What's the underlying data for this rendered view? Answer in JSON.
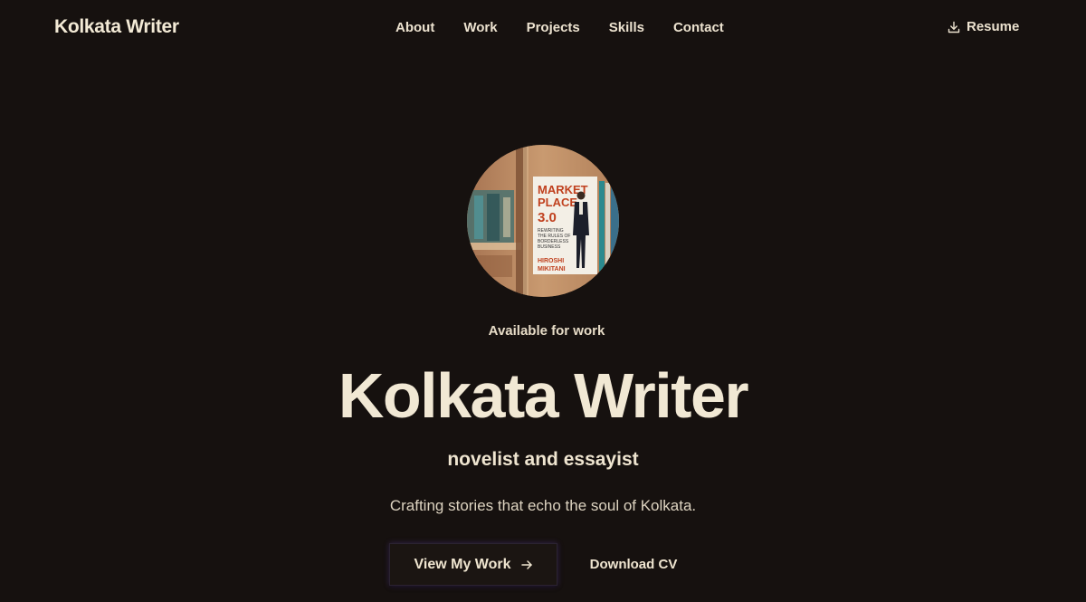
{
  "header": {
    "brand": "Kolkata Writer",
    "nav": [
      "About",
      "Work",
      "Projects",
      "Skills",
      "Contact"
    ],
    "resume_label": "Resume",
    "resume_icon": "download-icon"
  },
  "hero": {
    "avatar": {
      "book_title_line1": "MARKET",
      "book_title_line2": "PLACE",
      "book_title_line3": "3.0",
      "book_subtitle_lines": [
        "REWRITING",
        "THE RULES OF",
        "BORDERLESS",
        "BUSINESS"
      ],
      "book_author_lines": [
        "HIROSHI",
        "MIKITANI"
      ]
    },
    "availability": "Available for work",
    "title": "Kolkata Writer",
    "subtitle": "novelist and essayist",
    "tagline": "Crafting stories that echo the soul of Kolkata.",
    "primary_cta": "View My Work",
    "primary_cta_icon": "arrow-right-icon",
    "secondary_cta": "Download CV"
  },
  "colors": {
    "background": "#16110f",
    "text": "#f0e6d2",
    "book_accent": "#c0411f"
  }
}
